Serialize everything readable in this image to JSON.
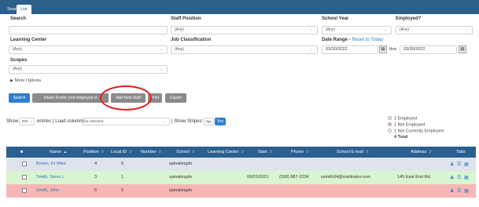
{
  "tabs": [
    "Search",
    "List"
  ],
  "filters": {
    "search": {
      "label": "Search",
      "value": ""
    },
    "staff_position": {
      "label": "Staff Position",
      "value": "(Any)"
    },
    "school_year": {
      "label": "School Year",
      "value": "(Any)"
    },
    "employed": {
      "label": "Employed?",
      "value": "(Any)"
    },
    "learning_center": {
      "label": "Learning Center",
      "value": "(Any)"
    },
    "job_classification": {
      "label": "Job Classification",
      "value": "(Any)"
    },
    "date_range": {
      "label": "Date Range - ",
      "reset": "Reset to Today",
      "from": "03/30/2022",
      "thru_label": "thru",
      "to": "03/30/2022"
    },
    "scopes": {
      "label": "Scopes",
      "value": "(Any)"
    },
    "more_options": "More Options"
  },
  "buttons": {
    "search": "Search",
    "intake": "Intake Roster (not employed st",
    "add_new_staff": "Add New Staff",
    "print": "Print",
    "export": "Export"
  },
  "list_controls": {
    "show": "Show",
    "entries_value": "500",
    "entries_label": "entries",
    "load_columns": "| Load columns:",
    "columns_value": "11 Selected",
    "show_stripes": "| Show Stripes:",
    "no": "No",
    "yes": "Yes"
  },
  "legend": {
    "employed": "2 Employed",
    "not_employed": "1 Not Employed",
    "not_currently": "1 Not Currently Employed",
    "total": "4 Total",
    "colors": {
      "employed": "#d8f5d0",
      "not_employed": "#f7b5b5",
      "not_currently": "#ffffff"
    }
  },
  "table": {
    "columns": [
      "Name",
      "Position",
      "Local ID",
      "Number",
      "School",
      "Learning Center",
      "Start",
      "Phone",
      "School E-mail",
      "Address",
      "Tabs"
    ],
    "rows": [
      {
        "name": "Brown, Dr Mike",
        "position": "4",
        "local_id": "0",
        "number": "",
        "school": "spinakingdo",
        "learning_center": "",
        "start": "",
        "phone": "",
        "email": "",
        "address": "",
        "color": "#dfe3ec"
      },
      {
        "name": "Smith, Steve L",
        "position": "3",
        "local_id": "1",
        "number": "",
        "school": "spinakingdo",
        "learning_center": "",
        "start": "09/01/2021",
        "phone": "(530) 887-2234",
        "email": "ssmith34@mailinator.com",
        "address": "145 East End Rd.",
        "color": "#d8f5d0"
      },
      {
        "name": "Smith, John",
        "position": "5",
        "local_id": "0",
        "number": "",
        "school": "spinakingdo",
        "learning_center": "",
        "start": "",
        "phone": "",
        "email": "",
        "address": "",
        "color": "#f7b5b5"
      }
    ]
  },
  "icons": [
    "user-icon",
    "list-icon",
    "columns-icon",
    "calendar-icon",
    "chevron-down-icon",
    "triangle-right-icon"
  ]
}
